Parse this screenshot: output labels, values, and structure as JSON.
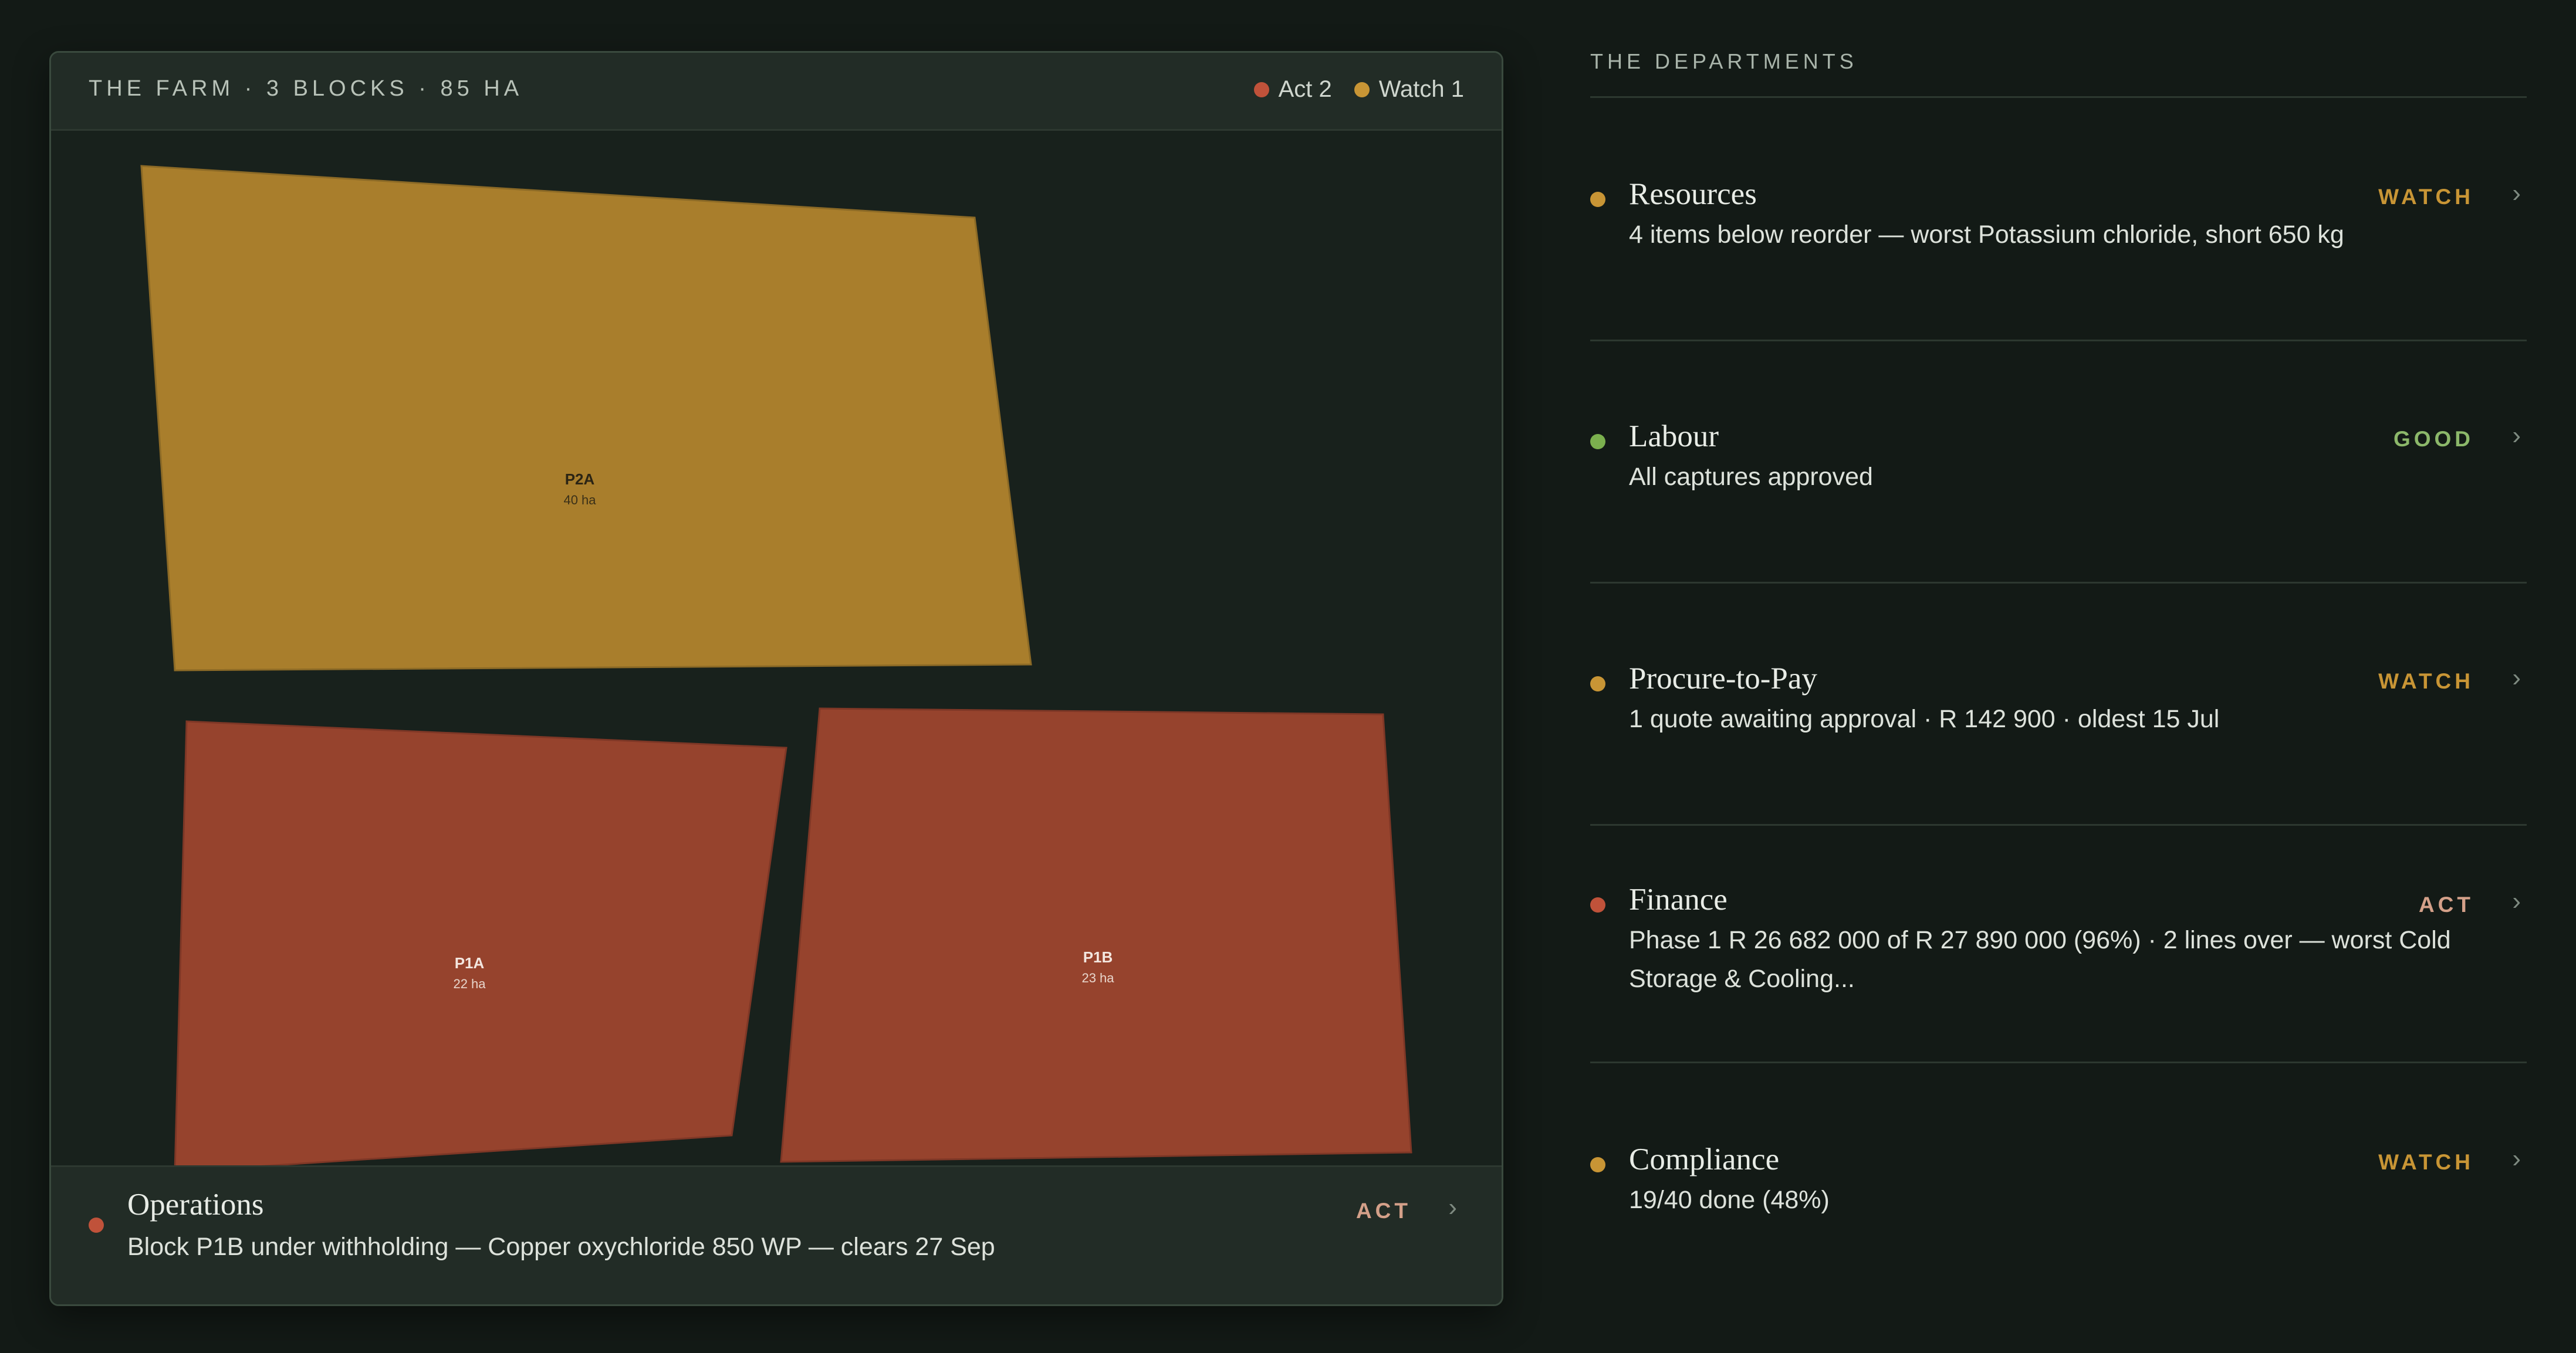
{
  "colors": {
    "act": "#c0523a",
    "watch": "#c89535",
    "good": "#7bb04e",
    "watch_fill": "#a97e2c",
    "act_fill": "#96432d"
  },
  "farm": {
    "title": "THE FARM · 3 BLOCKS · 85 HA",
    "legend": {
      "act": "Act 2",
      "watch": "Watch 1"
    },
    "blocks": [
      {
        "id": "P2A",
        "area": "40 ha",
        "status": "watch"
      },
      {
        "id": "P1A",
        "area": "22 ha",
        "status": "act"
      },
      {
        "id": "P1B",
        "area": "23 ha",
        "status": "act"
      }
    ],
    "operations": {
      "name": "Operations",
      "description": "Block P1B under withholding — Copper oxychloride 850 WP — clears 27 Sep",
      "status": "ACT",
      "chevron_icon": "chevron-right-icon"
    }
  },
  "departments": {
    "title": "THE DEPARTMENTS",
    "items": [
      {
        "name": "Resources",
        "description": "4 items below reorder — worst Potassium chloride, short 650 kg",
        "status": "WATCH"
      },
      {
        "name": "Labour",
        "description": "All captures approved",
        "status": "GOOD"
      },
      {
        "name": "Procure-to-Pay",
        "description": "1 quote awaiting approval · R 142 900 · oldest 15 Jul",
        "status": "WATCH"
      },
      {
        "name": "Finance",
        "description": "Phase 1 R 26 682 000 of R 27 890 000 (96%) · 2 lines over — worst Cold Storage & Cooling...",
        "status": "ACT"
      },
      {
        "name": "Compliance",
        "description": "19/40 done (48%)",
        "status": "WATCH"
      }
    ]
  }
}
